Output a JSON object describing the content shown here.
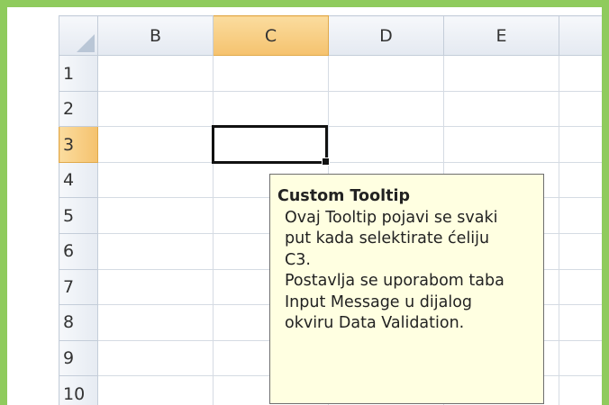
{
  "spreadsheet": {
    "column_headers": [
      "B",
      "C",
      "D",
      "E"
    ],
    "row_headers": [
      "1",
      "2",
      "3",
      "4",
      "5",
      "6",
      "7",
      "8",
      "9",
      "10"
    ],
    "selected_column": "C",
    "selected_row": "3",
    "active_cell": "C3"
  },
  "tooltip": {
    "title": "Custom Tooltip",
    "body": "Ovaj Tooltip pojavi se svaki\nput kada selektirate ćeliju\nC3.\nPostavlja se uporabom taba\nInput Message u dijalog\nokviru Data Validation."
  },
  "colors": {
    "frame_border": "#8fcb5d",
    "selected_header": "#f5c26e",
    "tooltip_background": "#ffffe1"
  }
}
